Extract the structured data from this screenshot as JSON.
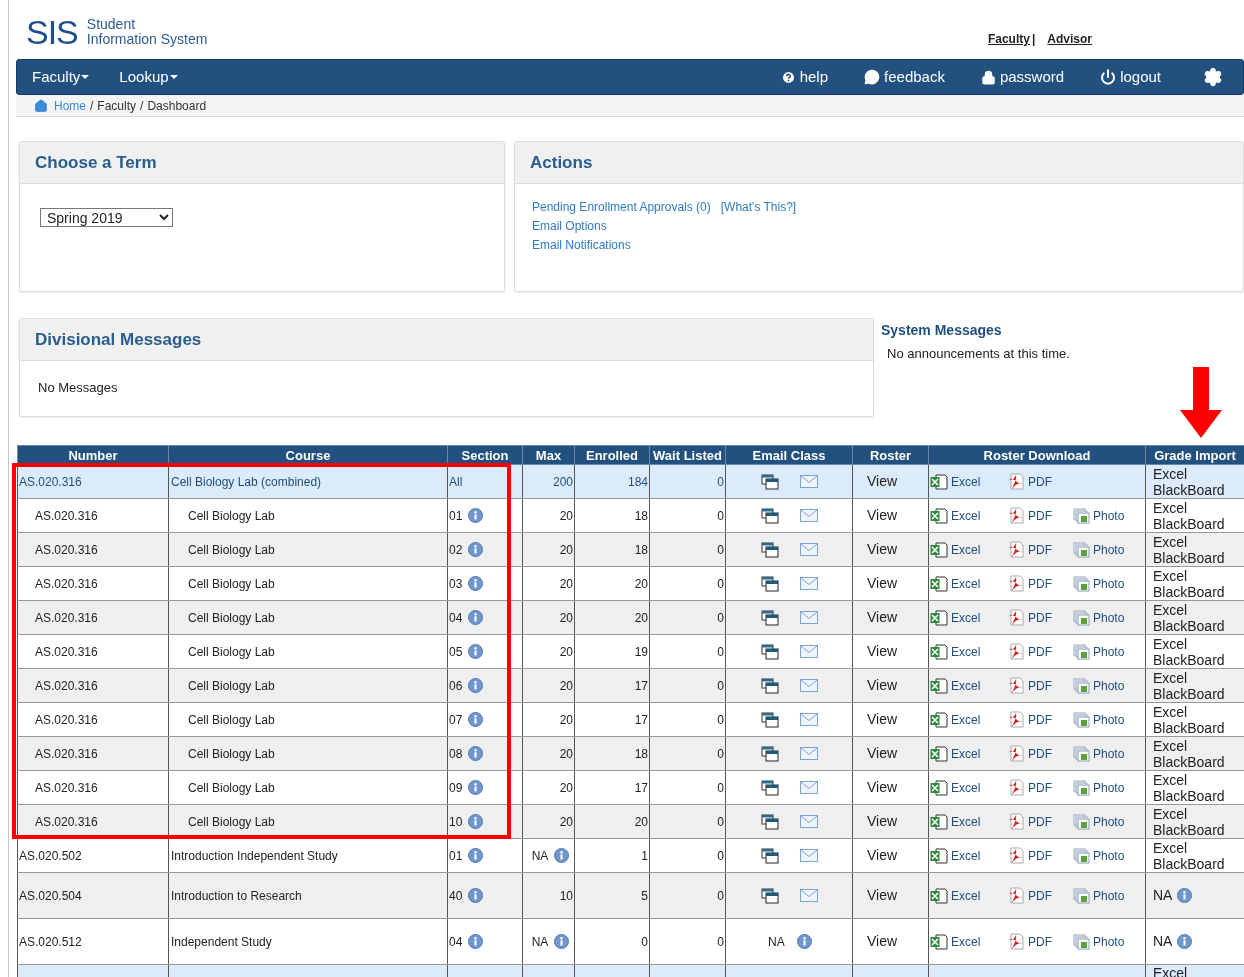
{
  "header": {
    "logo_mark": "SIS",
    "logo_line1": "Student",
    "logo_line2": "Information System",
    "role_links": [
      "Faculty",
      "Advisor"
    ],
    "role_separator": "|"
  },
  "nav": {
    "menus": [
      "Faculty",
      "Lookup"
    ],
    "items": [
      {
        "kind": "help",
        "label": "help"
      },
      {
        "kind": "feedback",
        "label": "feedback"
      },
      {
        "kind": "password",
        "label": "password"
      },
      {
        "kind": "logout",
        "label": "logout"
      },
      {
        "kind": "settings"
      }
    ]
  },
  "breadcrumb": {
    "items": [
      "Home",
      "Faculty",
      "Dashboard"
    ],
    "separator": "/"
  },
  "term_panel": {
    "title": "Choose a Term",
    "term": "Spring 2019"
  },
  "actions_panel": {
    "title": "Actions",
    "lines": [
      [
        "Pending Enrollment Approvals (0)",
        "[What's This?]"
      ],
      [
        "Email Options"
      ],
      [
        "Email Notifications"
      ]
    ]
  },
  "divisional_panel": {
    "title": "Divisional Messages",
    "body": "No Messages"
  },
  "system_messages": {
    "title": "System Messages",
    "body": "No announcements at this time."
  },
  "table": {
    "columns": [
      "Number",
      "Course",
      "Section",
      "Max",
      "Enrolled",
      "Wait Listed",
      "Email Class",
      "Roster",
      "Roster Download",
      "Grade Import"
    ],
    "rows": [
      {
        "number": "AS.020.316",
        "course": "Cell Biology Lab (combined)",
        "section": "All",
        "section_info": false,
        "max": "200",
        "max_info": false,
        "enrolled": "184",
        "wait_listed": "0",
        "email": {
          "kind": "icons"
        },
        "roster": "View",
        "downloads": [
          "Excel",
          "PDF"
        ],
        "grade_import": {
          "kind": "links",
          "lines": [
            "Excel",
            "BlackBoard"
          ]
        },
        "children": [
          {
            "number": "AS.020.316",
            "course": "Cell Biology Lab",
            "section": "01",
            "section_info": true,
            "max": "20",
            "max_info": false,
            "enrolled": "18",
            "wait_listed": "0",
            "email": {
              "kind": "icons"
            },
            "roster": "View",
            "downloads": [
              "Excel",
              "PDF",
              "Photo"
            ],
            "grade_import": {
              "kind": "links",
              "lines": [
                "Excel",
                "BlackBoard"
              ]
            }
          },
          {
            "number": "AS.020.316",
            "course": "Cell Biology Lab",
            "section": "02",
            "section_info": true,
            "max": "20",
            "max_info": false,
            "enrolled": "18",
            "wait_listed": "0",
            "email": {
              "kind": "icons"
            },
            "roster": "View",
            "downloads": [
              "Excel",
              "PDF",
              "Photo"
            ],
            "grade_import": {
              "kind": "links",
              "lines": [
                "Excel",
                "BlackBoard"
              ]
            }
          },
          {
            "number": "AS.020.316",
            "course": "Cell Biology Lab",
            "section": "03",
            "section_info": true,
            "max": "20",
            "max_info": false,
            "enrolled": "20",
            "wait_listed": "0",
            "email": {
              "kind": "icons"
            },
            "roster": "View",
            "downloads": [
              "Excel",
              "PDF",
              "Photo"
            ],
            "grade_import": {
              "kind": "links",
              "lines": [
                "Excel",
                "BlackBoard"
              ]
            }
          },
          {
            "number": "AS.020.316",
            "course": "Cell Biology Lab",
            "section": "04",
            "section_info": true,
            "max": "20",
            "max_info": false,
            "enrolled": "20",
            "wait_listed": "0",
            "email": {
              "kind": "icons"
            },
            "roster": "View",
            "downloads": [
              "Excel",
              "PDF",
              "Photo"
            ],
            "grade_import": {
              "kind": "links",
              "lines": [
                "Excel",
                "BlackBoard"
              ]
            }
          },
          {
            "number": "AS.020.316",
            "course": "Cell Biology Lab",
            "section": "05",
            "section_info": true,
            "max": "20",
            "max_info": false,
            "enrolled": "19",
            "wait_listed": "0",
            "email": {
              "kind": "icons"
            },
            "roster": "View",
            "downloads": [
              "Excel",
              "PDF",
              "Photo"
            ],
            "grade_import": {
              "kind": "links",
              "lines": [
                "Excel",
                "BlackBoard"
              ]
            }
          },
          {
            "number": "AS.020.316",
            "course": "Cell Biology Lab",
            "section": "06",
            "section_info": true,
            "max": "20",
            "max_info": false,
            "enrolled": "17",
            "wait_listed": "0",
            "email": {
              "kind": "icons"
            },
            "roster": "View",
            "downloads": [
              "Excel",
              "PDF",
              "Photo"
            ],
            "grade_import": {
              "kind": "links",
              "lines": [
                "Excel",
                "BlackBoard"
              ]
            }
          },
          {
            "number": "AS.020.316",
            "course": "Cell Biology Lab",
            "section": "07",
            "section_info": true,
            "max": "20",
            "max_info": false,
            "enrolled": "17",
            "wait_listed": "0",
            "email": {
              "kind": "icons"
            },
            "roster": "View",
            "downloads": [
              "Excel",
              "PDF",
              "Photo"
            ],
            "grade_import": {
              "kind": "links",
              "lines": [
                "Excel",
                "BlackBoard"
              ]
            }
          },
          {
            "number": "AS.020.316",
            "course": "Cell Biology Lab",
            "section": "08",
            "section_info": true,
            "max": "20",
            "max_info": false,
            "enrolled": "18",
            "wait_listed": "0",
            "email": {
              "kind": "icons"
            },
            "roster": "View",
            "downloads": [
              "Excel",
              "PDF",
              "Photo"
            ],
            "grade_import": {
              "kind": "links",
              "lines": [
                "Excel",
                "BlackBoard"
              ]
            }
          },
          {
            "number": "AS.020.316",
            "course": "Cell Biology Lab",
            "section": "09",
            "section_info": true,
            "max": "20",
            "max_info": false,
            "enrolled": "17",
            "wait_listed": "0",
            "email": {
              "kind": "icons"
            },
            "roster": "View",
            "downloads": [
              "Excel",
              "PDF",
              "Photo"
            ],
            "grade_import": {
              "kind": "links",
              "lines": [
                "Excel",
                "BlackBoard"
              ]
            }
          },
          {
            "number": "AS.020.316",
            "course": "Cell Biology Lab",
            "section": "10",
            "section_info": true,
            "max": "20",
            "max_info": false,
            "enrolled": "20",
            "wait_listed": "0",
            "email": {
              "kind": "icons"
            },
            "roster": "View",
            "downloads": [
              "Excel",
              "PDF",
              "Photo"
            ],
            "grade_import": {
              "kind": "links",
              "lines": [
                "Excel",
                "BlackBoard"
              ]
            }
          }
        ]
      },
      {
        "number": "AS.020.502",
        "course": "Introduction Independent Study",
        "section": "01",
        "section_info": true,
        "max": "NA",
        "max_info": true,
        "enrolled": "1",
        "wait_listed": "0",
        "email": {
          "kind": "icons"
        },
        "roster": "View",
        "downloads": [
          "Excel",
          "PDF",
          "Photo"
        ],
        "grade_import": {
          "kind": "links",
          "lines": [
            "Excel",
            "BlackBoard"
          ]
        }
      },
      {
        "number": "AS.020.504",
        "course": "Introduction to Research",
        "section": "40",
        "section_info": true,
        "max": "10",
        "max_info": false,
        "enrolled": "5",
        "wait_listed": "0",
        "email": {
          "kind": "icons"
        },
        "roster": "View",
        "downloads": [
          "Excel",
          "PDF",
          "Photo"
        ],
        "grade_import": {
          "kind": "na",
          "text": "NA"
        }
      },
      {
        "number": "AS.020.512",
        "course": "Independent Study",
        "section": "04",
        "section_info": true,
        "max": "NA",
        "max_info": true,
        "enrolled": "0",
        "wait_listed": "0",
        "email": {
          "kind": "na",
          "text": "NA"
        },
        "roster": "View",
        "downloads": [
          "Excel",
          "PDF",
          "Photo"
        ],
        "grade_import": {
          "kind": "na",
          "text": "NA"
        }
      },
      {
        "grade_import": {
          "kind": "links",
          "lines": [
            "Excel"
          ]
        }
      }
    ]
  }
}
